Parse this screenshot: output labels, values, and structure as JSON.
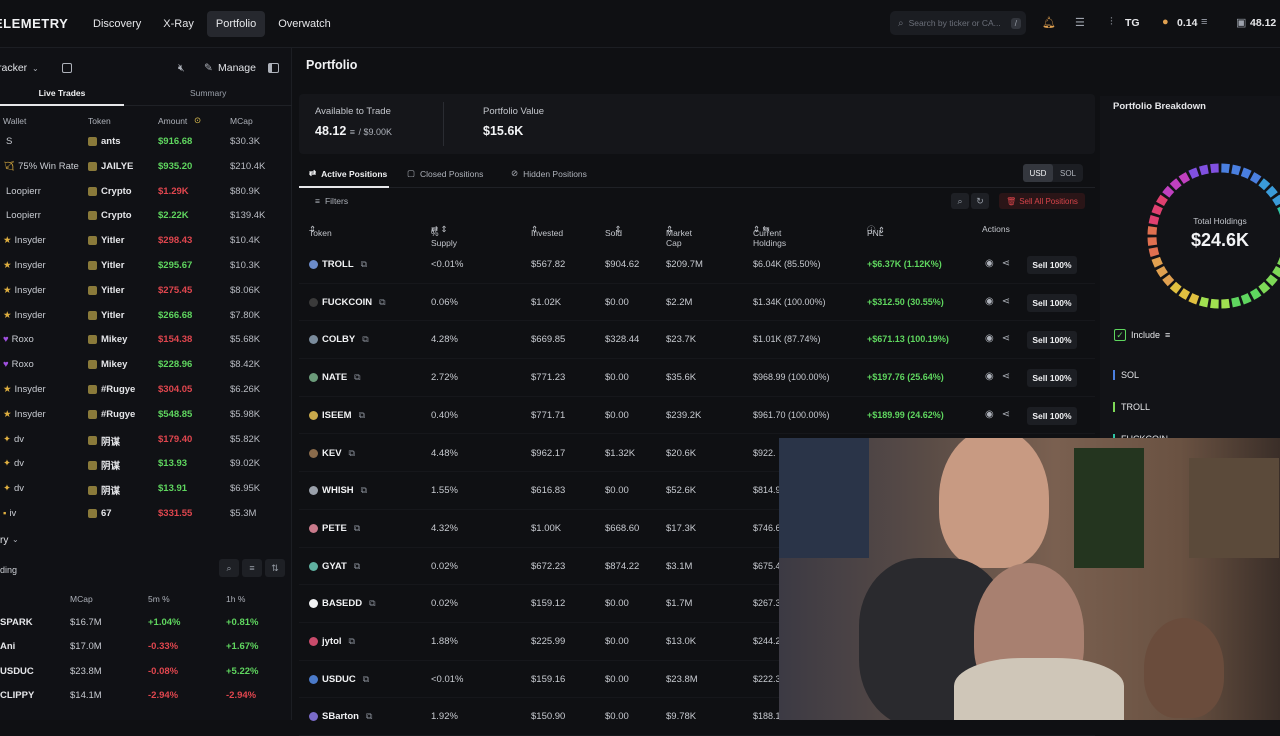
{
  "topbar": {
    "logo": "ELEMETRY",
    "nav": [
      "Discovery",
      "X-Ray",
      "Portfolio",
      "Overwatch"
    ],
    "active_nav": "Portfolio",
    "search_placeholder": "Search by ticker or CA...",
    "search_kbd": "/",
    "user": "TG",
    "sol_balance": "0.14",
    "wallet_balance": "48.12"
  },
  "left": {
    "tracker_label": "racker",
    "manage_label": "Manage",
    "tab_live": "Live Trades",
    "tab_summary": "Summary",
    "headers": {
      "wallet": "Wallet",
      "token": "Token",
      "amount": "Amount",
      "mcap": "MCap"
    },
    "trades": [
      {
        "wallet": "S",
        "token": "ants",
        "amount": "$916.68",
        "side": "buy",
        "mcap": "$30.3K"
      },
      {
        "wallet": "75% Win Rate",
        "token": "JAILYE",
        "amount": "$935.20",
        "side": "buy",
        "mcap": "$210.4K"
      },
      {
        "wallet": "Loopierr",
        "token": "Crypto",
        "amount": "$1.29K",
        "side": "sell",
        "mcap": "$80.9K"
      },
      {
        "wallet": "Loopierr",
        "token": "Crypto",
        "amount": "$2.22K",
        "side": "buy",
        "mcap": "$139.4K"
      },
      {
        "wallet": "Insyder",
        "token": "Yitler",
        "amount": "$298.43",
        "side": "sell",
        "mcap": "$10.4K"
      },
      {
        "wallet": "Insyder",
        "token": "Yitler",
        "amount": "$295.67",
        "side": "buy",
        "mcap": "$10.3K"
      },
      {
        "wallet": "Insyder",
        "token": "Yitler",
        "amount": "$275.45",
        "side": "sell",
        "mcap": "$8.06K"
      },
      {
        "wallet": "Insyder",
        "token": "Yitler",
        "amount": "$266.68",
        "side": "buy",
        "mcap": "$7.80K"
      },
      {
        "wallet": "Roxo",
        "token": "Mikey",
        "amount": "$154.38",
        "side": "sell",
        "mcap": "$5.68K"
      },
      {
        "wallet": "Roxo",
        "token": "Mikey",
        "amount": "$228.96",
        "side": "buy",
        "mcap": "$8.42K"
      },
      {
        "wallet": "Insyder",
        "token": "#Rugye",
        "amount": "$304.05",
        "side": "sell",
        "mcap": "$6.26K"
      },
      {
        "wallet": "Insyder",
        "token": "#Rugye",
        "amount": "$548.85",
        "side": "buy",
        "mcap": "$5.98K"
      },
      {
        "wallet": "dv",
        "token": "阴谋",
        "amount": "$179.40",
        "side": "sell",
        "mcap": "$5.82K"
      },
      {
        "wallet": "dv",
        "token": "阴谋",
        "amount": "$13.93",
        "side": "buy",
        "mcap": "$9.02K"
      },
      {
        "wallet": "dv",
        "token": "阴谋",
        "amount": "$13.91",
        "side": "buy",
        "mcap": "$6.95K"
      },
      {
        "wallet": "iv",
        "token": "67",
        "amount": "$331.55",
        "side": "sell",
        "mcap": "$5.3M"
      }
    ],
    "section2_title": "ry",
    "section2_sub": "ding",
    "headers2": {
      "mcap": "MCap",
      "m5": "5m %",
      "h1": "1h %"
    },
    "trending": [
      {
        "name": "SPARK",
        "mcap": "$16.7M",
        "m5": "+1.04%",
        "m5_dir": "up",
        "h1": "+0.81%",
        "h1_dir": "up"
      },
      {
        "name": "Ani",
        "mcap": "$17.0M",
        "m5": "-0.33%",
        "m5_dir": "down",
        "h1": "+1.67%",
        "h1_dir": "up"
      },
      {
        "name": "USDUC",
        "mcap": "$23.8M",
        "m5": "-0.08%",
        "m5_dir": "down",
        "h1": "+5.22%",
        "h1_dir": "up"
      },
      {
        "name": "CLIPPY",
        "mcap": "$14.1M",
        "m5": "-2.94%",
        "m5_dir": "down",
        "h1": "-2.94%",
        "h1_dir": "down"
      }
    ]
  },
  "main": {
    "title": "Portfolio",
    "available_label": "Available to Trade",
    "available_value": "48.12",
    "available_sub": "/ $9.00K",
    "value_label": "Portfolio Value",
    "value_value": "$15.6K",
    "tabs": [
      "Active Positions",
      "Closed Positions",
      "Hidden Positions"
    ],
    "currency": [
      "USD",
      "SOL"
    ],
    "filters_label": "Filters",
    "sell_all_label": "Sell All Positions",
    "headers": {
      "token": "Token",
      "supply": "% Supply",
      "invested": "Invested",
      "sold": "Sold",
      "mcap": "Market Cap",
      "holdings": "Current Holdings",
      "pnl": "PNL",
      "actions": "Actions"
    },
    "sell_label": "Sell 100%",
    "positions": [
      {
        "token": "TROLL",
        "supply": "<0.01%",
        "invested": "$567.82",
        "sold": "$904.62",
        "mcap": "$209.7M",
        "holdings": "$6.04K (85.50%)",
        "pnl": "+$6.37K (1.12K%)",
        "sell": true
      },
      {
        "token": "FUCKCOIN",
        "supply": "0.06%",
        "invested": "$1.02K",
        "sold": "$0.00",
        "mcap": "$2.2M",
        "holdings": "$1.34K (100.00%)",
        "pnl": "+$312.50 (30.55%)",
        "sell": true
      },
      {
        "token": "COLBY",
        "supply": "4.28%",
        "invested": "$669.85",
        "sold": "$328.44",
        "mcap": "$23.7K",
        "holdings": "$1.01K (87.74%)",
        "pnl": "+$671.13 (100.19%)",
        "sell": true
      },
      {
        "token": "NATE",
        "supply": "2.72%",
        "invested": "$771.23",
        "sold": "$0.00",
        "mcap": "$35.6K",
        "holdings": "$968.99 (100.00%)",
        "pnl": "+$197.76 (25.64%)",
        "sell": true
      },
      {
        "token": "ISEEM",
        "supply": "0.40%",
        "invested": "$771.71",
        "sold": "$0.00",
        "mcap": "$239.2K",
        "holdings": "$961.70 (100.00%)",
        "pnl": "+$189.99 (24.62%)",
        "sell": true
      },
      {
        "token": "KEV",
        "supply": "4.48%",
        "invested": "$962.17",
        "sold": "$1.32K",
        "mcap": "$20.6K",
        "holdings": "$922.",
        "pnl": "",
        "sell": false
      },
      {
        "token": "WHISH",
        "supply": "1.55%",
        "invested": "$616.83",
        "sold": "$0.00",
        "mcap": "$52.6K",
        "holdings": "$814.9",
        "pnl": "",
        "sell": false
      },
      {
        "token": "PETE",
        "supply": "4.32%",
        "invested": "$1.00K",
        "sold": "$668.60",
        "mcap": "$17.3K",
        "holdings": "$746.6",
        "pnl": "",
        "sell": false
      },
      {
        "token": "GYAT",
        "supply": "0.02%",
        "invested": "$672.23",
        "sold": "$874.22",
        "mcap": "$3.1M",
        "holdings": "$675.4",
        "pnl": "",
        "sell": false
      },
      {
        "token": "BASEDD",
        "supply": "0.02%",
        "invested": "$159.12",
        "sold": "$0.00",
        "mcap": "$1.7M",
        "holdings": "$267.3",
        "pnl": "",
        "sell": false
      },
      {
        "token": "jytol",
        "supply": "1.88%",
        "invested": "$225.99",
        "sold": "$0.00",
        "mcap": "$13.0K",
        "holdings": "$244.2",
        "pnl": "",
        "sell": false
      },
      {
        "token": "USDUC",
        "supply": "<0.01%",
        "invested": "$159.16",
        "sold": "$0.00",
        "mcap": "$23.8M",
        "holdings": "$222.3",
        "pnl": "",
        "sell": false
      },
      {
        "token": "SBarton",
        "supply": "1.92%",
        "invested": "$150.90",
        "sold": "$0.00",
        "mcap": "$9.78K",
        "holdings": "$188.1",
        "pnl": "",
        "sell": false
      }
    ]
  },
  "right": {
    "title": "Portfolio Breakdown",
    "total_label": "Total Holdings",
    "total_value": "$24.6K",
    "include_label": "Include",
    "legend": [
      {
        "name": "SOL",
        "color": "#4a7fe0"
      },
      {
        "name": "TROLL",
        "color": "#7ed957"
      },
      {
        "name": "FUCKCOIN",
        "color": "#2ec4a4"
      }
    ]
  },
  "colors": {
    "accent_green": "#5fd65f",
    "accent_red": "#e0464e"
  }
}
